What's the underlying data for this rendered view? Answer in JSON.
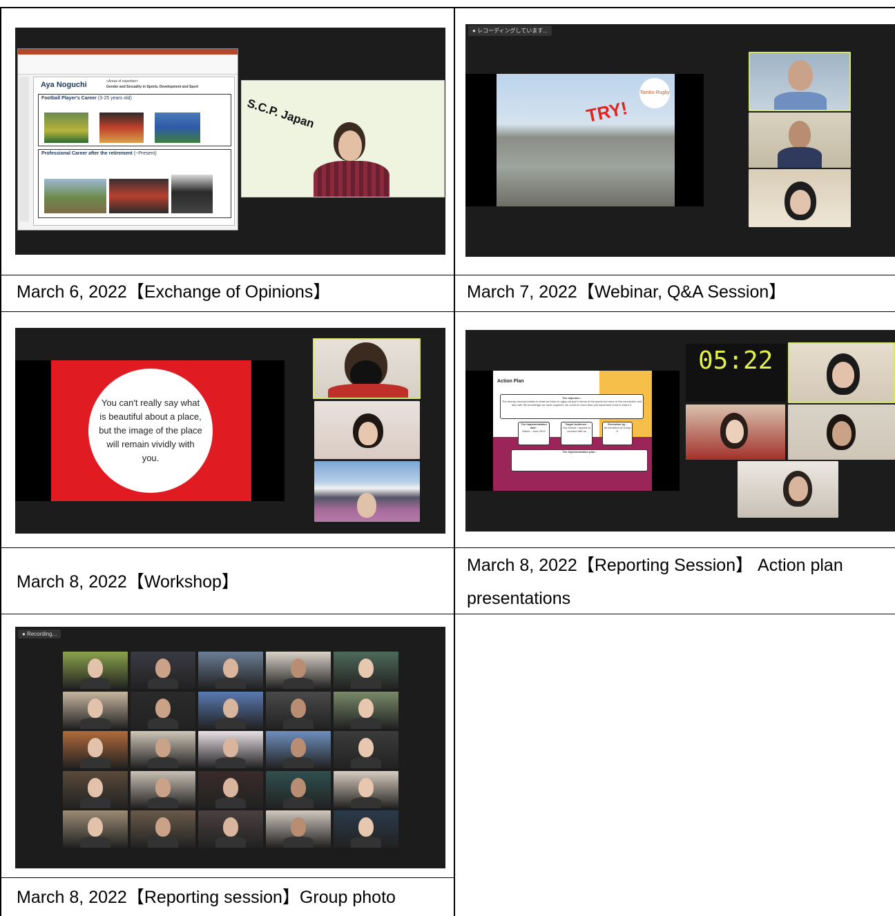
{
  "captions": {
    "c1": "March 6, 2022【Exchange of Opinions】",
    "c2": "March 7, 2022【Webinar, Q&A Session】",
    "c3": "March 8, 2022【Workshop】",
    "c4_line1": "March 8, 2022【Reporting Session】 Action plan",
    "c4_line2": "presentations",
    "c5": "March 8, 2022【Reporting session】Group photo"
  },
  "shot1": {
    "presenter_name": "Aya Noguchi",
    "expertise_head": "<Areas of expertise>",
    "expertise": "Gender and Sexuality in Sports, Development and Sport",
    "section1": "Football Player's Career",
    "section1_years": "(3-25 years old)",
    "section2": "Professional Career after the retirement",
    "section2_years": "(~Present)",
    "logo_text": "S.C.P. Japan"
  },
  "shot2": {
    "recording_label": "レコーディングしています...",
    "slide_text": "TRY!",
    "badge_text": "Tambo Rugby"
  },
  "shot3": {
    "quote": "You can't really say what is beautiful about a place, but the image of the place will remain vividly with you."
  },
  "shot4": {
    "timer": "05:22",
    "slide_title": "Action Plan",
    "objective_head": "The objective :",
    "objective_text": "The beauty concept relates to what we think of rugby not just in terms of the sports but more of the connection and also with the knowledge we have acquired, we could do more than just implement it but to share it.",
    "box1_head": "The Implementation date :",
    "box1_val": "March - June 2022",
    "box2_head": "Target Audience :",
    "box2_val": "Our friends / anyone to connect with us",
    "box3_head": "Execution by :",
    "box3_val": "All members of Group D",
    "plan_head": "The implementation plan :"
  },
  "shot5": {
    "recording_label": "Recording..."
  },
  "colors": {
    "zoom_bg": "#1e1e1e",
    "active_speaker": "#d6e66c",
    "slide_red": "#e01b22",
    "slide_purple": "#9b2559",
    "slide_yellow": "#f5bf49"
  }
}
